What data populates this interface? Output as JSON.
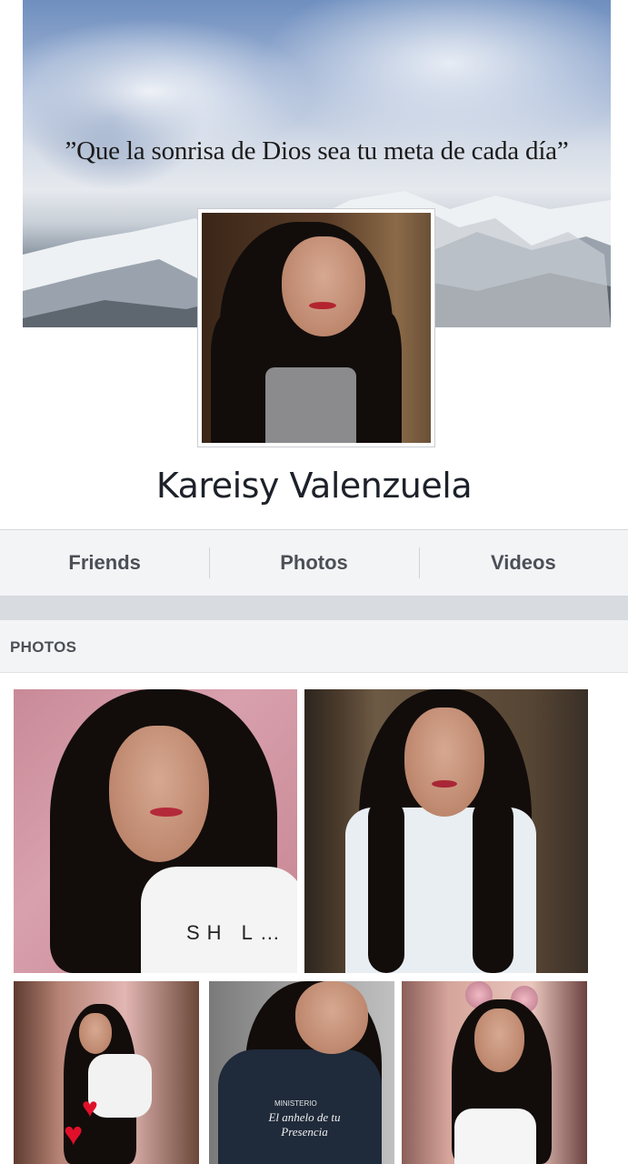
{
  "cover": {
    "quote": "”Que la sonrisa de Dios sea tu meta de cada día”"
  },
  "profile": {
    "name": "Kareisy Valenzuela"
  },
  "tabs": [
    {
      "label": "Friends"
    },
    {
      "label": "Photos"
    },
    {
      "label": "Videos"
    }
  ],
  "photos_section": {
    "heading": "PHOTOS",
    "items": [
      {
        "caption": "",
        "shirt_text": "SH L…"
      },
      {
        "caption": ""
      },
      {
        "caption": ""
      },
      {
        "caption": "",
        "shirt_text_top": "MINISTERIO",
        "shirt_text_script": "El anhelo de tu Presencia"
      },
      {
        "caption": ""
      }
    ]
  },
  "colors": {
    "tab_text": "#4b4f56",
    "name_text": "#1d2129",
    "band": "#d8dbe0",
    "header_bg": "#f3f4f6"
  }
}
